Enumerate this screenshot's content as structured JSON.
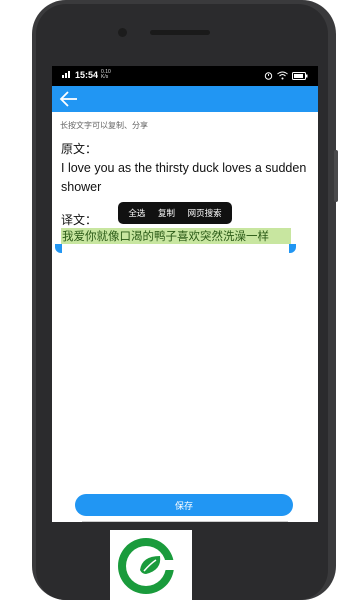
{
  "status_bar": {
    "time": "15:54",
    "network_speed": "0.10 K/s"
  },
  "app_bar": {
    "back_icon": "arrow-left-icon"
  },
  "content": {
    "hint": "长按文字可以复制、分享",
    "original_label": "原文：",
    "original_text": "I love you as the thirsty duck loves a sudden shower",
    "translation_label": "译文：",
    "translation_text": "我爱你就像口渴的鸭子喜欢突然洗澡一样"
  },
  "context_menu": {
    "items": [
      "全选",
      "复制",
      "网页搜索"
    ]
  },
  "save_button": {
    "label": "保存"
  },
  "colors": {
    "accent": "#2196f3",
    "selection": "#c8e6a0",
    "status_bar": "#000000",
    "logo_green": "#1a9b3c"
  },
  "logo": {
    "icon": "leaf-g-logo-icon"
  }
}
